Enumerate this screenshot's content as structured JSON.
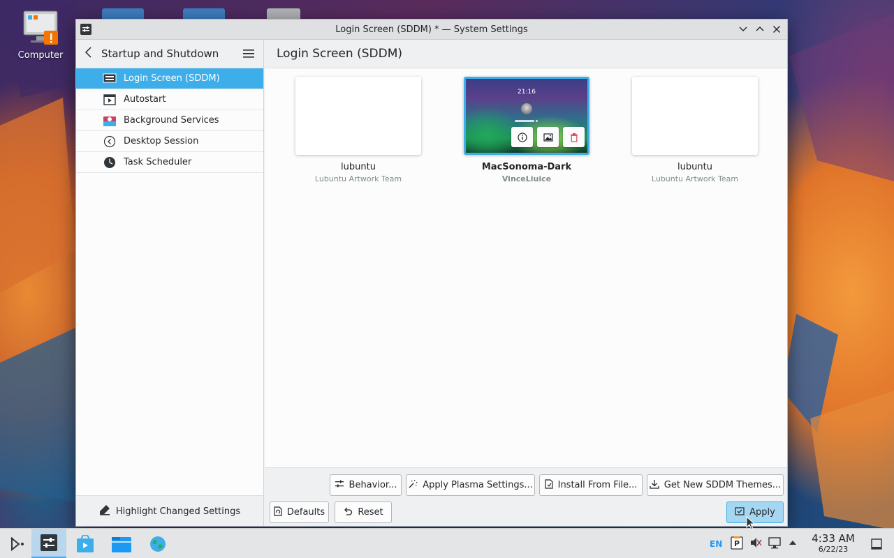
{
  "desktop": {
    "icons": [
      {
        "label": "Computer",
        "icon": "computer-warning-icon"
      }
    ]
  },
  "window": {
    "title": "Login Screen (SDDM) * — System Settings"
  },
  "sidebar": {
    "header": "Startup and Shutdown",
    "items": [
      {
        "label": "Login Screen (SDDM)",
        "icon": "login-screen-icon",
        "active": true
      },
      {
        "label": "Autostart",
        "icon": "autostart-icon"
      },
      {
        "label": "Background Services",
        "icon": "background-services-icon"
      },
      {
        "label": "Desktop Session",
        "icon": "desktop-session-icon"
      },
      {
        "label": "Task Scheduler",
        "icon": "task-scheduler-icon"
      }
    ],
    "footer": "Highlight Changed Settings"
  },
  "main": {
    "title": "Login Screen (SDDM)",
    "themes": [
      {
        "name": "lubuntu",
        "author": "Lubuntu Artwork Team",
        "selected": false
      },
      {
        "name": "MacSonoma-Dark",
        "author": "VinceLiuice",
        "selected": true,
        "preview_time": "21:16"
      },
      {
        "name": "lubuntu",
        "author": "Lubuntu Artwork Team",
        "selected": false
      }
    ],
    "actions": {
      "behavior": "Behavior...",
      "apply_plasma": "Apply Plasma Settings...",
      "install_from_file": "Install From File...",
      "get_new": "Get New SDDM Themes...",
      "defaults": "Defaults",
      "reset": "Reset",
      "apply": "Apply"
    }
  },
  "taskbar": {
    "tray": {
      "keyboard_layout": "EN",
      "time": "4:33 AM",
      "date": "6/22/23"
    }
  },
  "colors": {
    "accent": "#3daee9",
    "window_bg": "#eff0f1",
    "view_bg": "#fcfcfc"
  }
}
